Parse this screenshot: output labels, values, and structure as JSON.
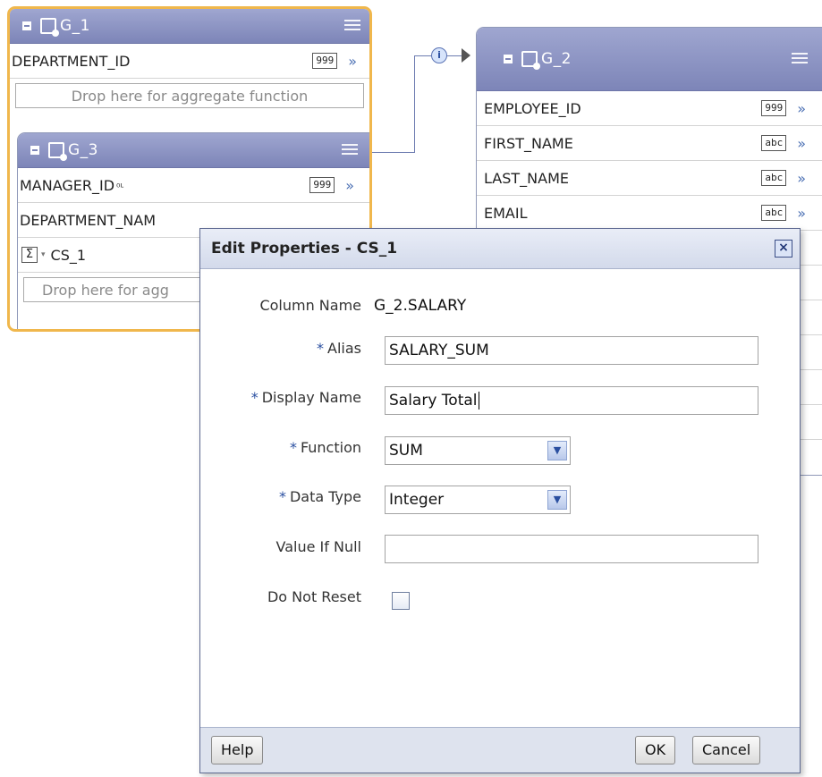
{
  "groups": {
    "g1": {
      "title": "G_1",
      "rows": [
        {
          "name": "DEPARTMENT_ID",
          "type": "999"
        }
      ],
      "drop_text": "Drop here for aggregate function"
    },
    "g3": {
      "title": "G_3",
      "rows": [
        {
          "name": "MANAGER_ID",
          "type": "999"
        },
        {
          "name": "DEPARTMENT_NAM",
          "type": ""
        }
      ],
      "summary_column": "CS_1",
      "drop_text": "Drop here for agg"
    },
    "g2": {
      "title": "G_2",
      "rows": [
        {
          "name": "EMPLOYEE_ID",
          "type": "999"
        },
        {
          "name": "FIRST_NAME",
          "type": "abc"
        },
        {
          "name": "LAST_NAME",
          "type": "abc"
        },
        {
          "name": "EMAIL",
          "type": "abc"
        }
      ]
    }
  },
  "dialog": {
    "title": "Edit Properties - CS_1",
    "close_glyph": "×",
    "column_name_label": "Column Name",
    "column_name_value": "G_2.SALARY",
    "alias_label": "Alias",
    "alias_value": "SALARY_SUM",
    "display_name_label": "Display Name",
    "display_name_value": "Salary Total",
    "function_label": "Function",
    "function_value": "SUM",
    "data_type_label": "Data Type",
    "data_type_value": "Integer",
    "value_if_null_label": "Value If Null",
    "value_if_null_value": "",
    "do_not_reset_label": "Do Not Reset",
    "do_not_reset_checked": false,
    "required_marker": "*",
    "help_button": "Help",
    "ok_button": "OK",
    "cancel_button": "Cancel"
  },
  "glyphs": {
    "chevron": "»",
    "sigma": "Σ",
    "dropdown": "▼",
    "info": "i",
    "caret": "▾"
  }
}
